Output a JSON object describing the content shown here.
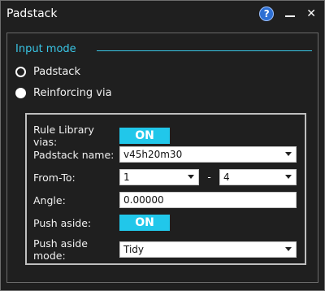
{
  "window": {
    "title": "Padstack"
  },
  "input_mode": {
    "title": "Input mode",
    "options": [
      {
        "label": "Padstack",
        "selected": false
      },
      {
        "label": "Reinforcing via",
        "selected": true
      }
    ]
  },
  "form": {
    "rule_library_vias": {
      "label": "Rule Library vias:",
      "value": "ON"
    },
    "padstack_name": {
      "label": "Padstack name:",
      "value": "v45h20m30"
    },
    "from_to": {
      "label": "From-To:",
      "from": "1",
      "separator": "-",
      "to": "4"
    },
    "angle": {
      "label": "Angle:",
      "value": "0.00000"
    },
    "push_aside": {
      "label": "Push aside:",
      "value": "ON"
    },
    "push_aside_mode": {
      "label": "Push aside mode:",
      "value": "Tidy"
    }
  },
  "colors": {
    "accent": "#21c7ea",
    "section_title": "#39c6e6",
    "background": "#1f1f1f"
  }
}
